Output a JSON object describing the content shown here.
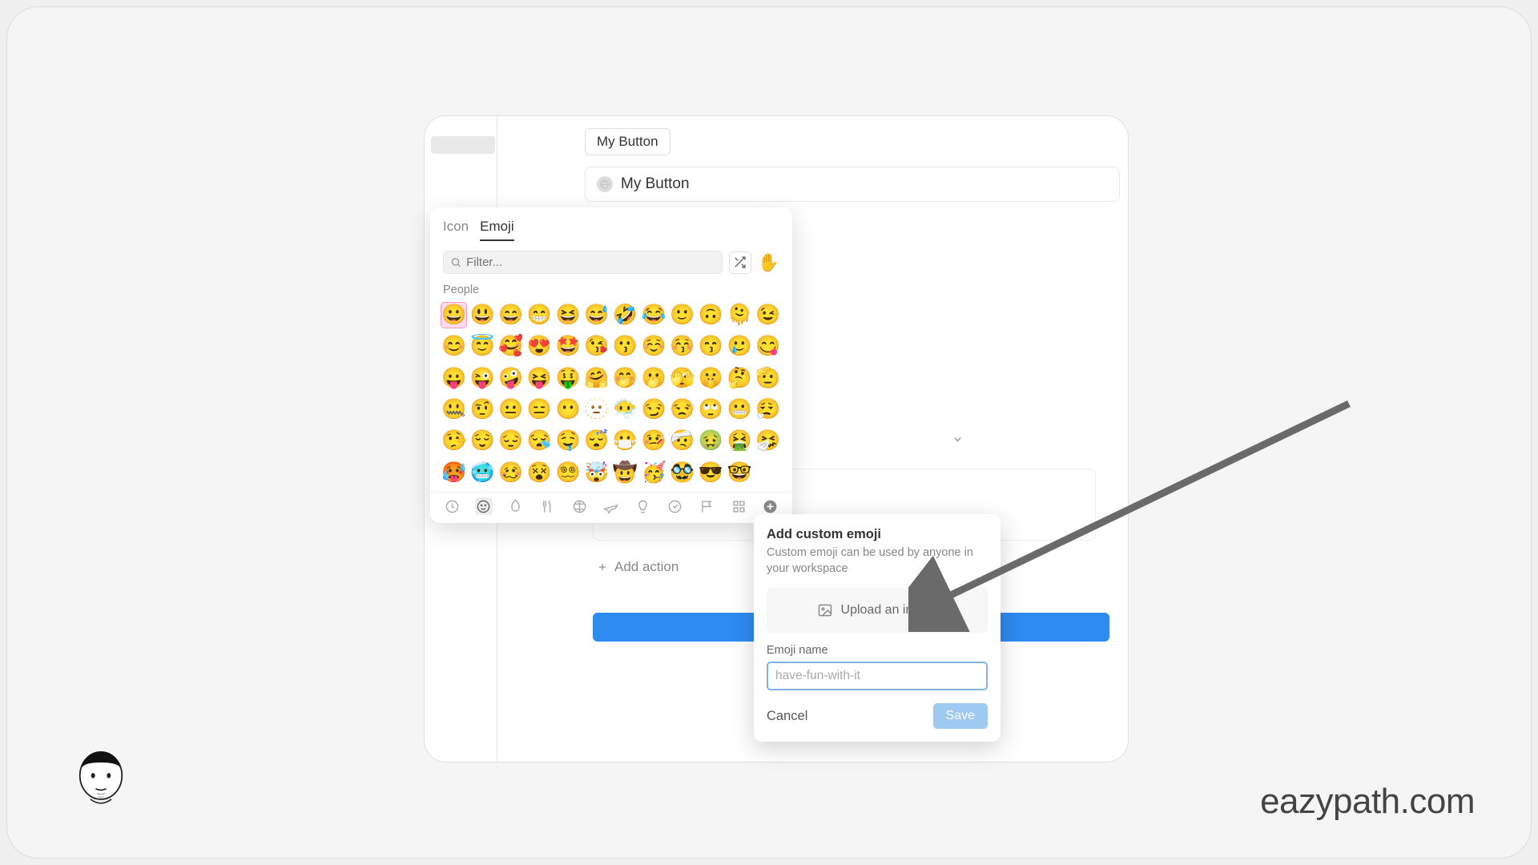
{
  "header": {
    "tab_label": "My Button"
  },
  "button_card": {
    "title": "My Button"
  },
  "add_action_label": "Add action",
  "picker": {
    "tabs": [
      "Icon",
      "Emoji"
    ],
    "active_tab": "Emoji",
    "search_placeholder": "Filter...",
    "skin_tone_emoji": "✋",
    "section_label": "People",
    "emojis": [
      "😀",
      "😃",
      "😄",
      "😁",
      "😆",
      "😅",
      "🤣",
      "😂",
      "🙂",
      "🙃",
      "🫠",
      "😉",
      "😊",
      "😇",
      "🥰",
      "😍",
      "🤩",
      "😘",
      "😗",
      "☺️",
      "😚",
      "😙",
      "🥲",
      "😋",
      "😛",
      "😜",
      "🤪",
      "😝",
      "🤑",
      "🤗",
      "🤭",
      "🫢",
      "🫣",
      "🤫",
      "🤔",
      "🫡",
      "🤐",
      "🤨",
      "😐",
      "😑",
      "😶",
      "🫥",
      "😶‍🌫️",
      "😏",
      "😒",
      "🙄",
      "😬",
      "😮‍💨",
      "🤥",
      "😌",
      "😔",
      "😪",
      "🤤",
      "😴",
      "😷",
      "🤒",
      "🤕",
      "🤢",
      "🤮",
      "🤧",
      "🥵",
      "🥶",
      "🥴",
      "😵",
      "😵‍💫",
      "🤯",
      "🤠",
      "🥳",
      "🥸",
      "😎",
      "🤓"
    ]
  },
  "custom_emoji": {
    "title": "Add custom emoji",
    "subtitle": "Custom emoji can be used by anyone in your workspace",
    "upload_label": "Upload an image",
    "field_label": "Emoji name",
    "name_placeholder": "have-fun-with-it",
    "cancel_label": "Cancel",
    "save_label": "Save"
  },
  "watermark": "eazypath.com"
}
